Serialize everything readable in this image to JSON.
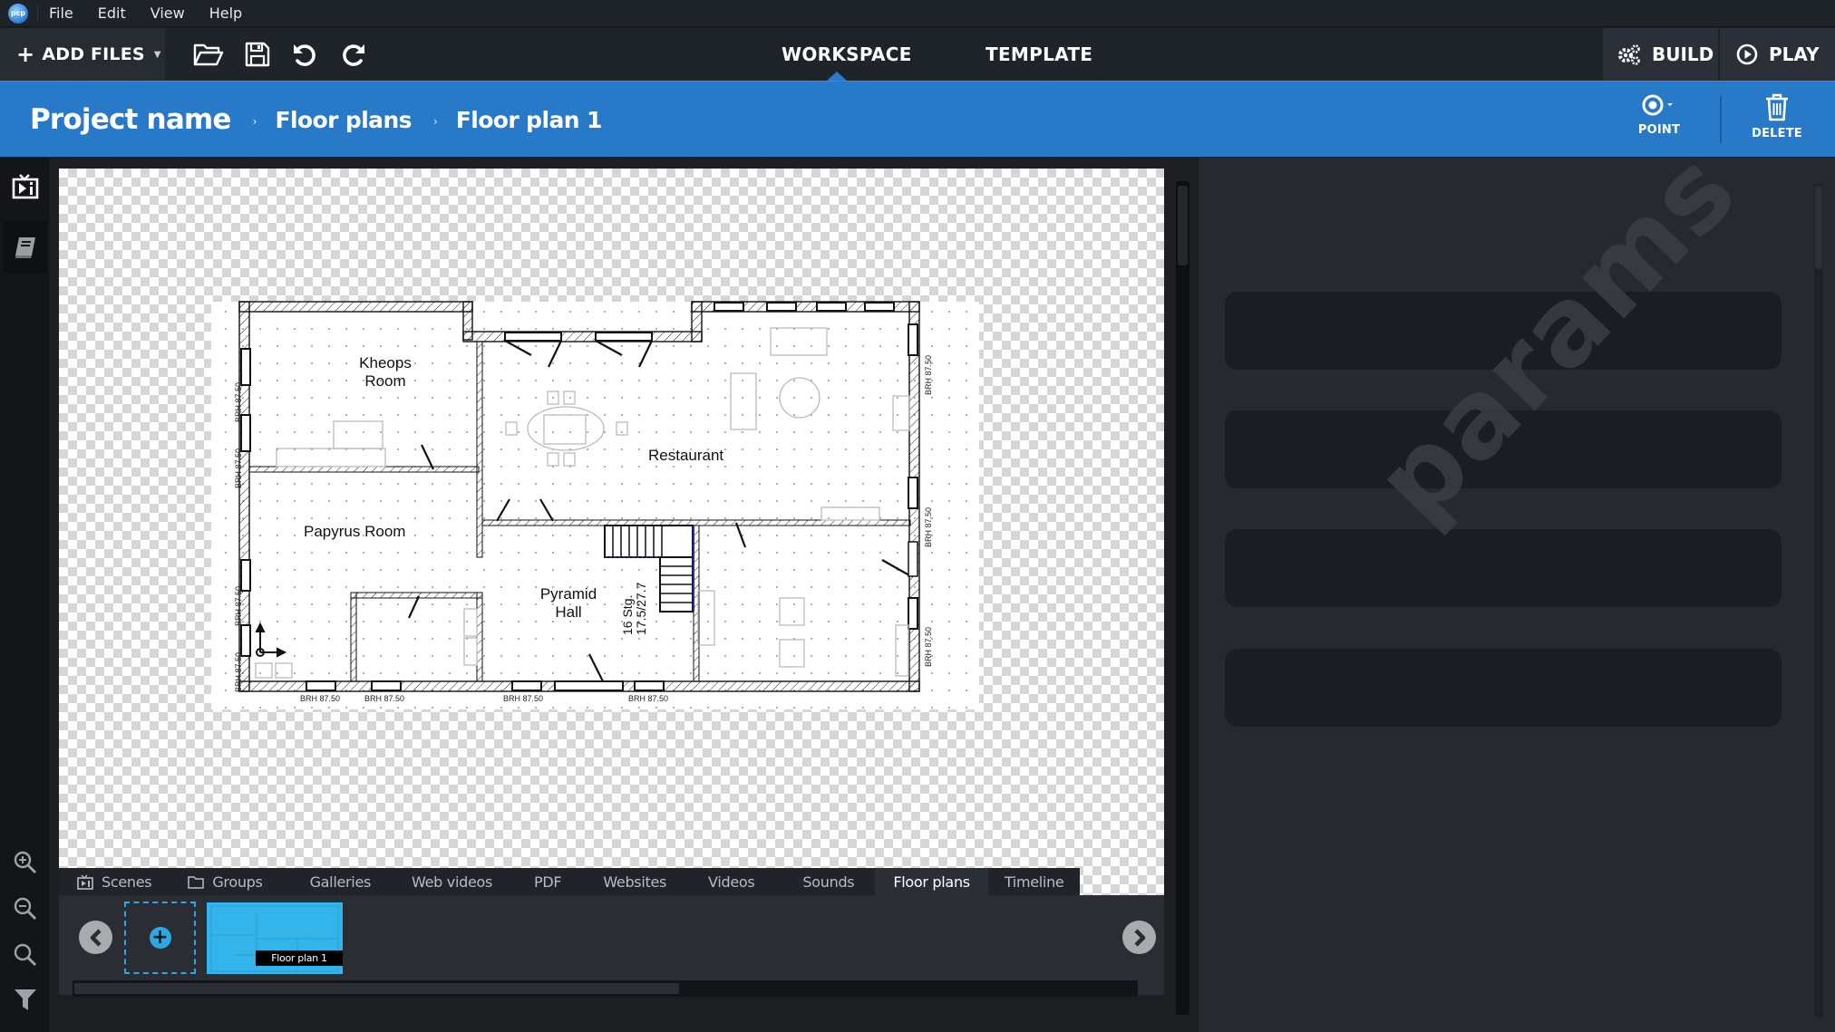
{
  "menu": {
    "logo": "pcp",
    "items": [
      "File",
      "Edit",
      "View",
      "Help"
    ]
  },
  "toolbar": {
    "add_files_label": "ADD FILES",
    "icons": [
      "open-folder-icon",
      "save-icon",
      "undo-icon",
      "redo-icon"
    ],
    "tabs": [
      {
        "label": "WORKSPACE",
        "active": true
      },
      {
        "label": "TEMPLATE",
        "active": false
      }
    ],
    "build_label": "BUILD",
    "play_label": "PLAY"
  },
  "breadcrumb": {
    "project": "Project name",
    "items": [
      "Floor plans",
      "Floor plan 1"
    ],
    "separator": "›"
  },
  "actions": {
    "point_label": "POINT",
    "delete_label": "DELETE"
  },
  "sidebar": {
    "top_icons": [
      "scenes-tv-icon",
      "book-icon"
    ],
    "bottom_icons": [
      "zoom-in-icon",
      "zoom-out-icon",
      "zoom-fit-icon",
      "filter-icon"
    ]
  },
  "floor_plan": {
    "rooms": [
      {
        "name": "Kheops",
        "name2": "Room"
      },
      {
        "name": "Restaurant"
      },
      {
        "name": "Papyrus Room"
      },
      {
        "name": "Pyramid",
        "name2": "Hall"
      }
    ],
    "stair_label_1": "16 Stg.",
    "stair_label_2": "17.5/27.7",
    "window_label": "BRH 87.50"
  },
  "bottom_tabs": {
    "items": [
      {
        "label": "Scenes",
        "icon": "scenes-tv-icon",
        "active": false
      },
      {
        "label": "Groups",
        "icon": "folder-icon",
        "active": false
      },
      {
        "label": "Galleries",
        "active": false
      },
      {
        "label": "Web videos",
        "active": false
      },
      {
        "label": "PDF",
        "active": false
      },
      {
        "label": "Websites",
        "active": false
      },
      {
        "label": "Videos",
        "active": false
      },
      {
        "label": "Sounds",
        "active": false
      },
      {
        "label": "Floor plans",
        "active": true
      },
      {
        "label": "Timeline",
        "active": false
      }
    ]
  },
  "filmstrip": {
    "items": [
      {
        "label": "Floor plan 1",
        "selected": true
      }
    ],
    "scroll_fraction": 0.57
  },
  "params_panel": {
    "watermark": "params",
    "slot_count": 4
  },
  "colors": {
    "accent_blue": "#2879c8",
    "thumbnail_blue": "#33b4ea",
    "add_slot_blue": "#2ea7e0"
  }
}
